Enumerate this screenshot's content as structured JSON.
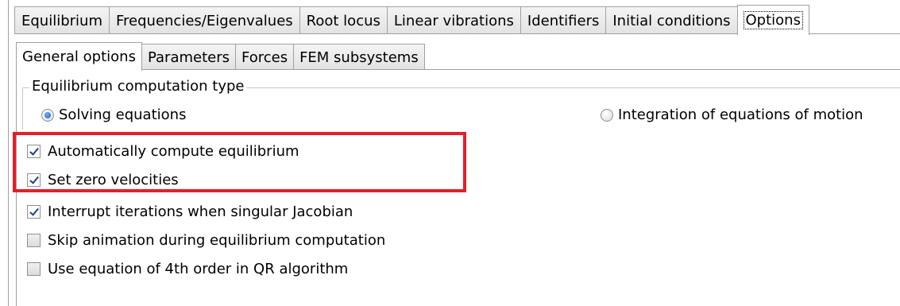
{
  "top_tabs": [
    {
      "label": "Equilibrium"
    },
    {
      "label": "Frequencies/Eigenvalues"
    },
    {
      "label": "Root locus"
    },
    {
      "label": "Linear vibrations"
    },
    {
      "label": "Identifiers"
    },
    {
      "label": "Initial conditions"
    },
    {
      "label": "Options"
    }
  ],
  "top_tab_active": "Options",
  "inner_tabs": [
    {
      "label": "General options"
    },
    {
      "label": "Parameters"
    },
    {
      "label": "Forces"
    },
    {
      "label": "FEM subsystems"
    }
  ],
  "inner_tab_active": "General options",
  "equilibrium_group": {
    "title": "Equilibrium computation type",
    "radio_solving": {
      "label": "Solving equations",
      "checked": true
    },
    "radio_integration": {
      "label": "Integration of equations of motion",
      "checked": false
    }
  },
  "options": [
    {
      "label": "Automatically compute equilibrium",
      "checked": true
    },
    {
      "label": "Set zero velocities",
      "checked": true
    },
    {
      "label": "Interrupt iterations when singular Jacobian",
      "checked": true
    },
    {
      "label": "Skip animation during equilibrium computation",
      "checked": false
    },
    {
      "label": "Use equation of 4th order in QR algorithm",
      "checked": false
    }
  ],
  "colors": {
    "highlight": "#e0202a",
    "radio_accent": "#1c5fb8",
    "check_accent": "#1c3f8f"
  }
}
